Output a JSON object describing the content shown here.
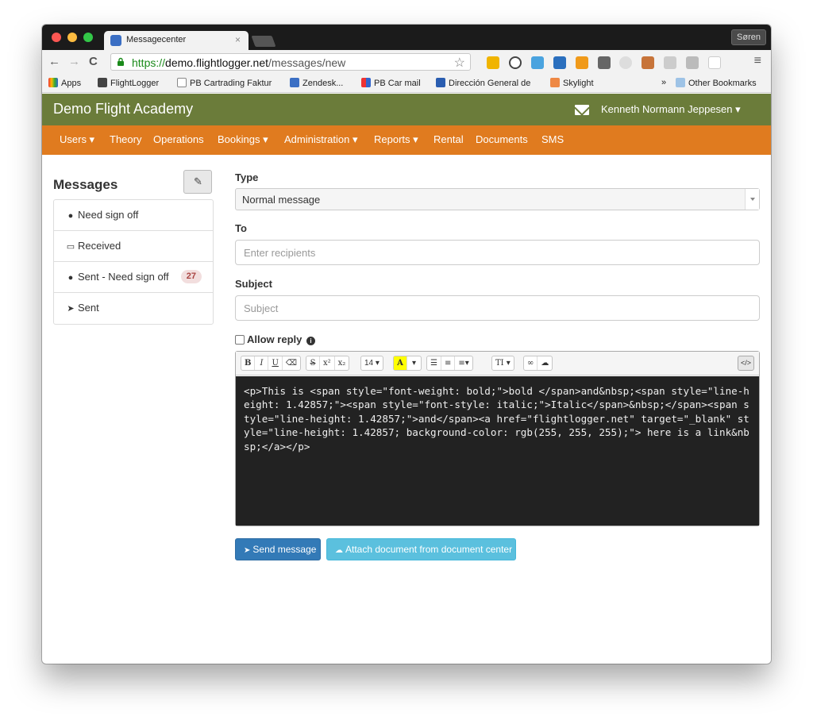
{
  "browser": {
    "tab_title": "Messagecenter",
    "tab_close": "×",
    "profile_name": "Søren",
    "url_scheme": "https://",
    "url_host": "demo.flightlogger.net",
    "url_path": "/messages/new",
    "bookmarks": [
      {
        "label": "Apps"
      },
      {
        "label": "FlightLogger"
      },
      {
        "label": "PB Cartrading Faktur"
      },
      {
        "label": "Zendesk..."
      },
      {
        "label": "PB Car mail"
      },
      {
        "label": "Dirección General de"
      },
      {
        "label": "Skylight"
      }
    ],
    "bookmarks_overflow": "»",
    "other_bookmarks": "Other Bookmarks"
  },
  "app": {
    "brand": "Demo Flight Academy",
    "user_name": "Kenneth Normann Jeppesen ▾",
    "nav": [
      {
        "label": "Users ▾"
      },
      {
        "label": "Theory"
      },
      {
        "label": "Operations"
      },
      {
        "label": "Bookings ▾"
      },
      {
        "label": "Administration ▾"
      },
      {
        "label": "Reports ▾"
      },
      {
        "label": "Rental"
      },
      {
        "label": "Documents"
      },
      {
        "label": "SMS"
      }
    ],
    "colors": {
      "header": "#6b7c3a",
      "nav": "#e07b1f"
    }
  },
  "sidebar": {
    "title": "Messages",
    "items": [
      {
        "label": "Need sign off",
        "icon": "exclamation-circle-icon"
      },
      {
        "label": "Received",
        "icon": "inbox-icon"
      },
      {
        "label": "Sent - Need sign off",
        "icon": "exclamation-circle-icon",
        "badge": "27"
      },
      {
        "label": "Sent",
        "icon": "paper-plane-icon"
      }
    ]
  },
  "form": {
    "type_label": "Type",
    "type_value": "Normal message",
    "to_label": "To",
    "to_placeholder": "Enter recipients",
    "subject_label": "Subject",
    "subject_placeholder": "Subject",
    "allow_reply_label": "Allow reply",
    "editor": {
      "font_size": "14",
      "code": "<p>This is <span style=\"font-weight: bold;\">bold </span>and&nbsp;<span style=\"line-height: 1.42857;\"><span style=\"font-style: italic;\">Italic</span>&nbsp;</span><span style=\"line-height: 1.42857;\">and</span><a href=\"flightlogger.net\" target=\"_blank\" style=\"line-height: 1.42857; background-color: rgb(255, 255, 255);\"> here is a link&nbsp;</a></p>"
    },
    "send_label": "Send message",
    "attach_label": "Attach document from document center"
  }
}
